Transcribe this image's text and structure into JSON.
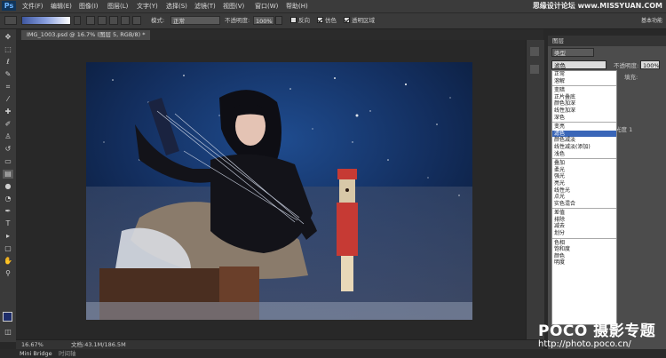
{
  "app": {
    "logo": "Ps",
    "colors": {
      "accent": "#3a66b8",
      "ps_blue": "#6fb6ff"
    }
  },
  "menu": [
    "文件(F)",
    "编辑(E)",
    "图像(I)",
    "图层(L)",
    "文字(Y)",
    "选择(S)",
    "滤镜(T)",
    "视图(V)",
    "窗口(W)",
    "帮助(H)"
  ],
  "watermark": {
    "site": "思缘设计论坛 www.MISSYUAN.COM",
    "sub": "基本功能"
  },
  "options": {
    "mode_label": "模式:",
    "mode_value": "正常",
    "opacity_label": "不透明度:",
    "opacity_value": "100%",
    "reverse_label": "反向",
    "dither_label": "仿色",
    "transparency_label": "透明区域"
  },
  "document": {
    "tab_title": "IMG_1003.psd @ 16.7% (图层 5, RGB/8) *",
    "close": "×"
  },
  "status": {
    "zoom": "16.67%",
    "doc_info": "文档:43.1M/186.5M"
  },
  "bottom_tabs": [
    "Mini Bridge",
    "时间轴"
  ],
  "layers_panel": {
    "title": "图层",
    "kind_label": "类型",
    "blend_value": "滤色",
    "opacity_label": "不透明度:",
    "opacity_value": "100%",
    "fill_label": "填充:",
    "fill_value": "100%",
    "partial_text": "光度 1"
  },
  "blend_groups": [
    [
      "正常",
      "溶解"
    ],
    [
      "变暗",
      "正片叠底",
      "颜色加深",
      "线性加深",
      "深色"
    ],
    [
      "变亮",
      "滤色",
      "颜色减淡",
      "线性减淡(添加)",
      "浅色"
    ],
    [
      "叠加",
      "柔光",
      "强光",
      "亮光",
      "线性光",
      "点光",
      "实色混合"
    ],
    [
      "差值",
      "排除",
      "减去",
      "划分"
    ],
    [
      "色相",
      "饱和度",
      "颜色",
      "明度"
    ]
  ],
  "selected_blend": "滤色",
  "poco": {
    "brand": "POCO 摄影专题",
    "url": "http://photo.poco.cn/"
  }
}
